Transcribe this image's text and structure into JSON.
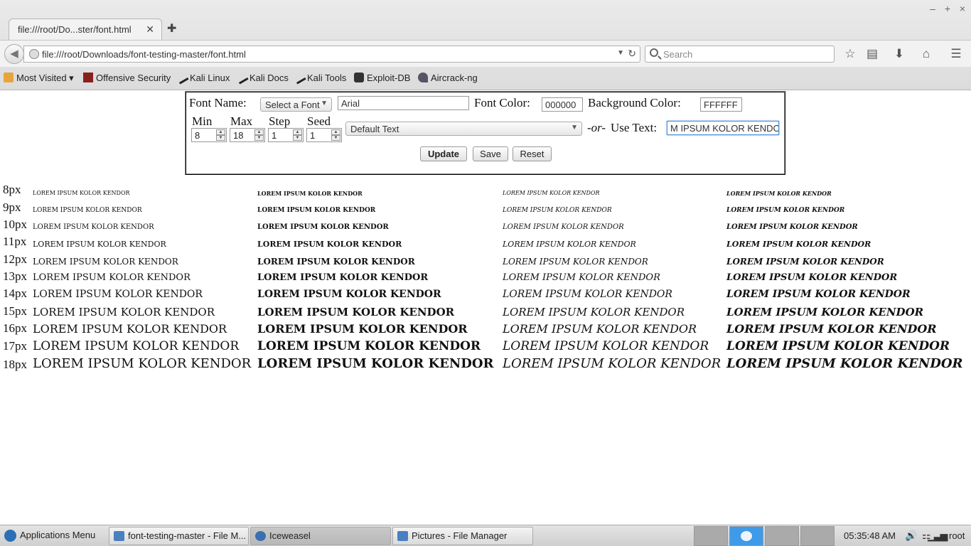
{
  "browser": {
    "tab_title": "file:///root/Do...ster/font.html",
    "url": "file:///root/Downloads/font-testing-master/font.html",
    "search_placeholder": "Search",
    "bookmarks": [
      "Most Visited ▾",
      "Offensive Security",
      "Kali Linux",
      "Kali Docs",
      "Kali Tools",
      "Exploit-DB",
      "Aircrack-ng"
    ]
  },
  "controls": {
    "font_name_label": "Font Name:",
    "font_select": "Select a Font",
    "font_value": "Arial",
    "font_color_label": "Font Color:",
    "font_color_value": "000000",
    "bg_color_label": "Background Color:",
    "bg_color_value": "FFFFFF",
    "min_label": "Min",
    "min_value": "8",
    "max_label": "Max",
    "max_value": "18",
    "step_label": "Step",
    "step_value": "1",
    "seed_label": "Seed",
    "seed_value": "1",
    "text_select": "Default Text",
    "or_label": "-or-",
    "use_text_label": "Use Text:",
    "use_text_value": "M IPSUM KOLOR KENDOR",
    "update_button": "Update",
    "save_button": "Save",
    "reset_button": "Reset"
  },
  "samples": {
    "text": "LOREM IPSUM KOLOR KENDOR",
    "sizes": [
      "8px",
      "9px",
      "10px",
      "11px",
      "12px",
      "13px",
      "14px",
      "15px",
      "16px",
      "17px",
      "18px"
    ]
  },
  "taskbar": {
    "apps_menu": "Applications Menu",
    "tasks": [
      "font-testing-master - File M...",
      "Iceweasel",
      "Pictures - File Manager"
    ],
    "clock": "05:35:48 AM",
    "user": "root"
  },
  "colors": {
    "accent": "#3d9be9",
    "focus": "#4a90d9"
  }
}
